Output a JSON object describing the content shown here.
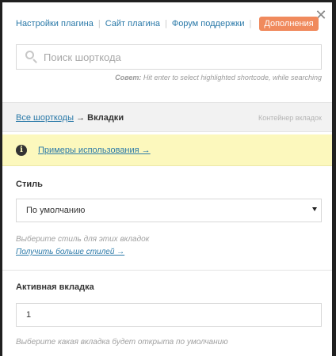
{
  "header": {
    "links": [
      {
        "label": "Настройки плагина"
      },
      {
        "label": "Сайт плагина"
      },
      {
        "label": "Форум поддержки"
      }
    ],
    "addons_label": "Дополнения",
    "close_glyph": "✕"
  },
  "search": {
    "placeholder": "Поиск шорткода",
    "value": "",
    "hint_prefix": "Совет:",
    "hint_text": " Hit enter to select highlighted shortcode, while searching"
  },
  "breadcrumb": {
    "all_label": "Все шорткоды",
    "arrow": "→",
    "current": "Вкладки",
    "right_text": "Контейнер вкладок"
  },
  "notice": {
    "icon": "info-icon",
    "link_label": "Примеры использования →"
  },
  "fields": {
    "style": {
      "label": "Стиль",
      "selected": "По умолчанию",
      "description": "Выберите стиль для этих вкладок",
      "more_link": "Получить больше стилей →"
    },
    "active_tab": {
      "label": "Активная вкладка",
      "value": "1",
      "description": "Выберите какая вкладка будет открыта по умолчанию"
    }
  },
  "colors": {
    "link": "#2a79a8",
    "addons_bg": "#f08a5d",
    "notice_bg": "#fcf8bd",
    "crumbbar_bg": "#f2f2f2"
  }
}
